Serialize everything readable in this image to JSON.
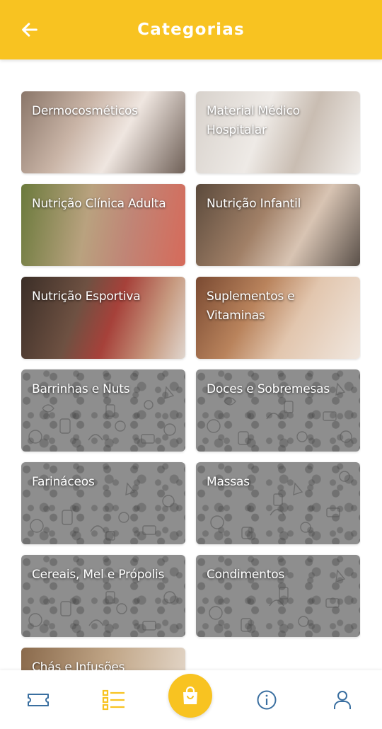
{
  "header": {
    "title": "Categorias",
    "back_icon": "arrow-left-icon"
  },
  "colors": {
    "accent": "#f8c321",
    "nav_icon": "#3a6fa0",
    "nav_active": "#f8c321",
    "card_pattern": "#8e8e8e"
  },
  "categories": [
    {
      "label": "Dermocosméticos",
      "background": "photo"
    },
    {
      "label": "Material Médico Hospitalar",
      "background": "photo"
    },
    {
      "label": "Nutrição Clínica Adulta",
      "background": "photo"
    },
    {
      "label": "Nutrição Infantil",
      "background": "photo"
    },
    {
      "label": "Nutrição Esportiva",
      "background": "photo"
    },
    {
      "label": "Suplementos e Vitaminas",
      "background": "photo"
    },
    {
      "label": "Barrinhas e Nuts",
      "background": "pattern"
    },
    {
      "label": "Doces e Sobremesas",
      "background": "pattern"
    },
    {
      "label": "Farináceos",
      "background": "pattern"
    },
    {
      "label": "Massas",
      "background": "pattern"
    },
    {
      "label": "Cereais, Mel e Própolis",
      "background": "pattern"
    },
    {
      "label": "Condimentos",
      "background": "pattern"
    },
    {
      "label": "Chás e Infusões",
      "background": "photo"
    }
  ],
  "bottom_nav": {
    "items": [
      {
        "icon": "ticket-icon",
        "active": false
      },
      {
        "icon": "list-icon",
        "active": true
      },
      {
        "icon": "shopping-bag-icon",
        "active": false
      },
      {
        "icon": "info-icon",
        "active": false
      },
      {
        "icon": "user-icon",
        "active": false
      }
    ]
  }
}
